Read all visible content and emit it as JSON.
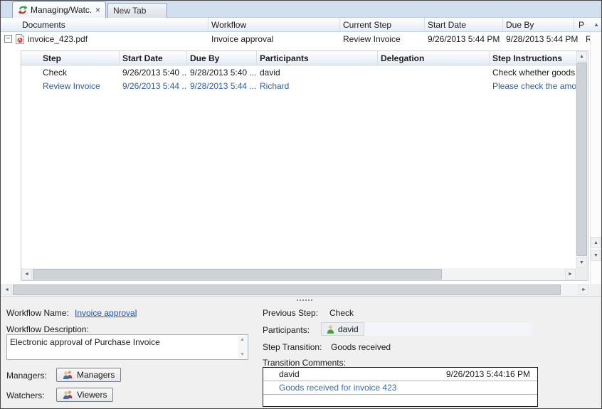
{
  "colors": {
    "link_blue": "#1a56b0",
    "step_highlight_blue": "#2b5fa3",
    "comment_blue": "#3a6ca8",
    "pdf_red": "#d23b2a",
    "tab_bar_bg": "#d2dfee"
  },
  "icons": {
    "close_tab": "×",
    "sort_ascending": "▲",
    "collapse_row": "−",
    "scroll_up": "▲",
    "scroll_down": "▼",
    "scroll_left": "◄",
    "scroll_right": "►"
  },
  "tabs": [
    {
      "label": "Managing/Watc...",
      "active": true
    },
    {
      "label": "New Tab",
      "active": false
    }
  ],
  "grid": {
    "columns": [
      "Documents",
      "Workflow",
      "Current Step",
      "Start Date",
      "Due By",
      "P"
    ],
    "row": {
      "document": "invoice_423.pdf",
      "workflow": "Invoice approval",
      "current_step": "Review Invoice",
      "start_date": "9/26/2013 5:44 PM",
      "due_by": "9/28/2013 5:44 PM",
      "priority": "R"
    }
  },
  "steps": {
    "columns": [
      "Step",
      "Start Date",
      "Due By",
      "Participants",
      "Delegation",
      "Step Instructions"
    ],
    "rows": [
      {
        "step": "Check",
        "start_date": "9/26/2013 5:40 ...",
        "due_by": "9/28/2013 5:40 ...",
        "participants": "david",
        "delegation": "",
        "instructions": "Check whether goods re"
      },
      {
        "step": "Review Invoice",
        "start_date": "9/26/2013 5:44 ...",
        "due_by": "9/28/2013 5:44 ...",
        "participants": "Richard",
        "delegation": "",
        "instructions": "Please check the amount"
      }
    ]
  },
  "panel": {
    "workflow_name_label": "Workflow Name:",
    "workflow_name": "Invoice approval",
    "workflow_description_label": "Workflow Description:",
    "workflow_description": "Electronic approval of Purchase Invoice",
    "managers_label": "Managers:",
    "managers_button": "Managers",
    "watchers_label": "Watchers:",
    "watchers_button": "Viewers",
    "previous_step_label": "Previous Step:",
    "previous_step": "Check",
    "participants_label": "Participants:",
    "participant": "david",
    "step_transition_label": "Step Transition:",
    "step_transition": "Goods received",
    "transition_comments_label": "Transition Comments:",
    "comment": {
      "author": "david",
      "timestamp": "9/26/2013 5:44:16 PM",
      "text": "Goods received for invoice 423"
    }
  }
}
